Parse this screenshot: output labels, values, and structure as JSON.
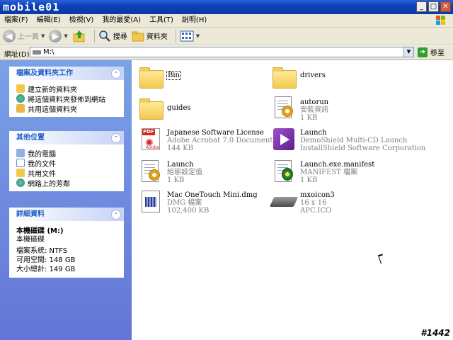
{
  "window": {
    "logo": "mobile01"
  },
  "menu": [
    "檔案(F)",
    "編輯(E)",
    "檢視(V)",
    "我的最愛(A)",
    "工具(T)",
    "說明(H)"
  ],
  "toolbar": {
    "back": "上一頁",
    "search": "搜尋",
    "folders": "資料夾"
  },
  "address": {
    "label": "網址(D)",
    "value": "M:\\",
    "go": "移至"
  },
  "tasks": {
    "title": "檔案及資料夾工作",
    "items": [
      "建立新的資料夾",
      "將這個資料夾發佈到網站",
      "共用這個資料夾"
    ]
  },
  "places": {
    "title": "其他位置",
    "items": [
      "我的電腦",
      "我的文件",
      "共用文件",
      "網路上的芳鄰"
    ]
  },
  "details": {
    "title": "詳細資料",
    "name": "本機磁碟 (M:)",
    "type": "本機磁碟",
    "fs": "檔案系統: NTFS",
    "free": "可用空間: 148 GB",
    "total": "大小總計: 149 GB"
  },
  "files": [
    {
      "name": "Bin",
      "sub1": "",
      "sub2": "",
      "icon": "folder-icon"
    },
    {
      "name": "drivers",
      "sub1": "",
      "sub2": "",
      "icon": "folder-icon"
    },
    {
      "name": "guides",
      "sub1": "",
      "sub2": "",
      "icon": "folder-icon"
    },
    {
      "name": "autorun",
      "sub1": "安裝資訊",
      "sub2": "1 KB",
      "icon": "settings-file-icon"
    },
    {
      "name": "Japanese Software License",
      "sub1": "Adobe Acrobat 7.0 Document",
      "sub2": "144 KB",
      "icon": "pdf-icon"
    },
    {
      "name": "Launch",
      "sub1": "DemoShield Multi-CD Launch",
      "sub2": "InstallShield Software Corporation",
      "icon": "demoshield-icon"
    },
    {
      "name": "Launch",
      "sub1": "組態設定值",
      "sub2": "1 KB",
      "icon": "config-file-icon"
    },
    {
      "name": "Launch.exe.manifest",
      "sub1": "MANIFEST 檔案",
      "sub2": "1 KB",
      "icon": "manifest-icon"
    },
    {
      "name": "Mac OneTouch Mini.dmg",
      "sub1": "DMG 檔案",
      "sub2": "102,400 KB",
      "icon": "dmg-file-icon"
    },
    {
      "name": "mxoicon3",
      "sub1": "16 x 16",
      "sub2": "APC.ICO",
      "icon": "drive-icon"
    }
  ],
  "watermark": "#1442"
}
